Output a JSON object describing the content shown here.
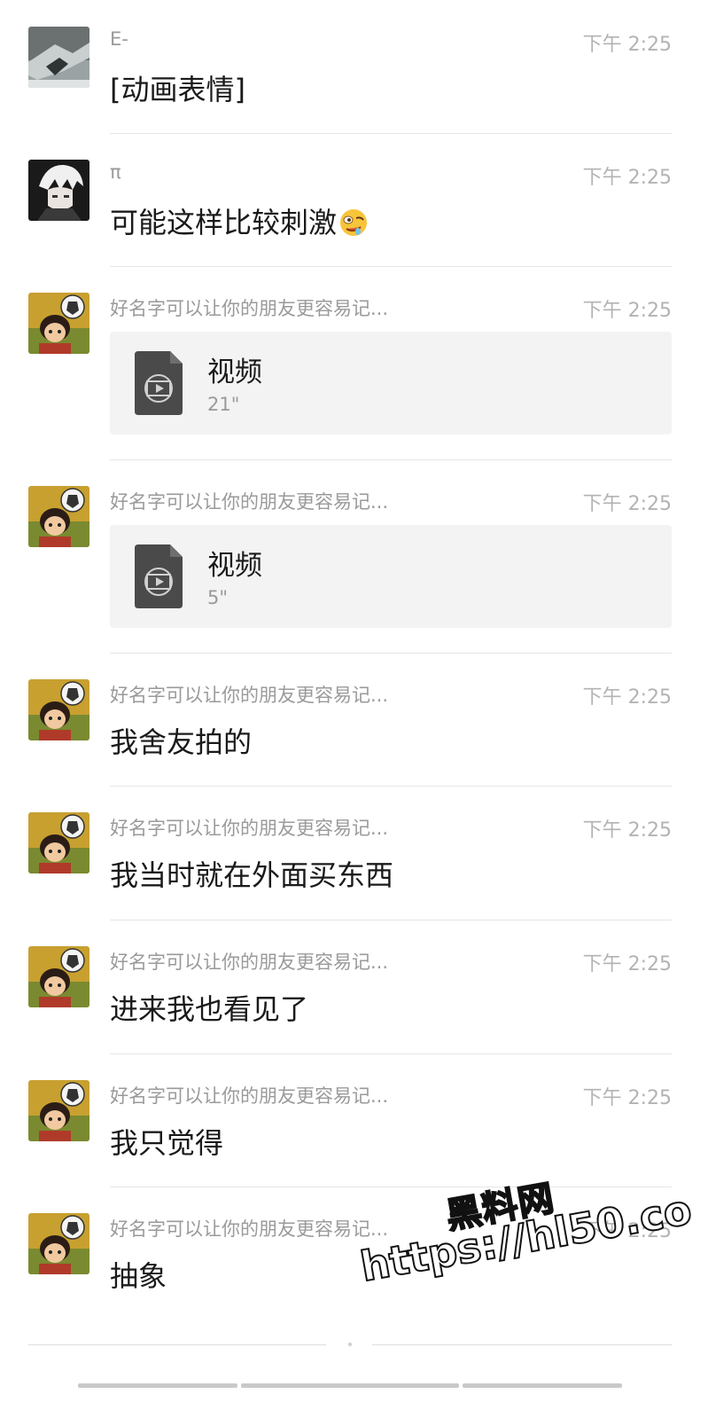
{
  "messages": [
    {
      "sender": "E-",
      "time": "下午 2:25",
      "text": "[动画表情]",
      "avatar": "photo-avatar-E"
    },
    {
      "sender": "π",
      "time": "下午 2:25",
      "text": "可能这样比较刺激",
      "emoji": "drooling-face-emoji",
      "avatar": "anime-white-hair-avatar"
    },
    {
      "sender": "好名字可以让你的朋友更容易记...",
      "time": "下午 2:25",
      "video": {
        "title": "视频",
        "duration": "21\""
      },
      "avatar": "cartoon-boy-football-avatar"
    },
    {
      "sender": "好名字可以让你的朋友更容易记...",
      "time": "下午 2:25",
      "video": {
        "title": "视频",
        "duration": "5\""
      },
      "avatar": "cartoon-boy-football-avatar"
    },
    {
      "sender": "好名字可以让你的朋友更容易记...",
      "time": "下午 2:25",
      "text": "我舍友拍的",
      "avatar": "cartoon-boy-football-avatar"
    },
    {
      "sender": "好名字可以让你的朋友更容易记...",
      "time": "下午 2:25",
      "text": "我当时就在外面买东西",
      "avatar": "cartoon-boy-football-avatar"
    },
    {
      "sender": "好名字可以让你的朋友更容易记...",
      "time": "下午 2:25",
      "text": "进来我也看见了",
      "avatar": "cartoon-boy-football-avatar"
    },
    {
      "sender": "好名字可以让你的朋友更容易记...",
      "time": "下午 2:25",
      "text": "我只觉得",
      "avatar": "cartoon-boy-football-avatar"
    },
    {
      "sender": "好名字可以让你的朋友更容易记...",
      "time": "下午 2:25",
      "text": "抽象",
      "avatar": "cartoon-boy-football-avatar"
    }
  ],
  "watermark": {
    "line1": "黑料网",
    "line2": "https://hl50.co"
  },
  "colors": {
    "sender": "#9a9a9a",
    "time": "#b3b3b3",
    "text": "#1a1a1a",
    "card_bg": "#f3f3f3",
    "divider": "#e6e6e6"
  }
}
